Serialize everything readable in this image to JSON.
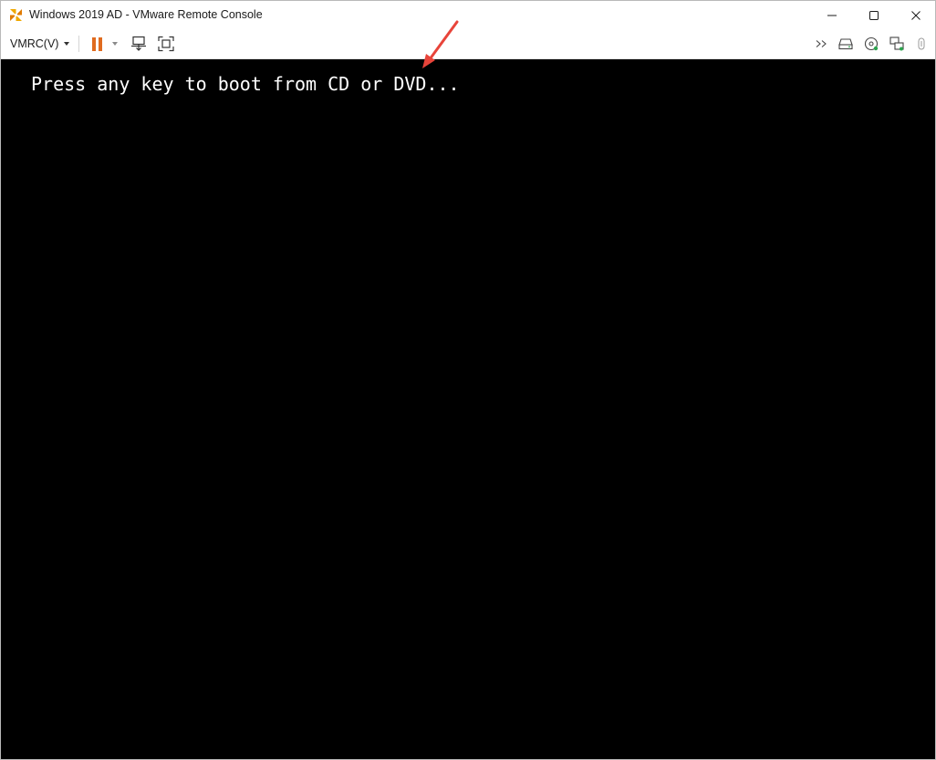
{
  "window": {
    "title": "Windows 2019 AD - VMware Remote Console",
    "app_icon": "vmware-pinwheel-icon",
    "controls": [
      "minimize-icon",
      "maximize-icon",
      "close-icon"
    ]
  },
  "toolbar": {
    "menu_label": "VMRC(V)",
    "left_icons": [
      "pause-icon",
      "dropdown-caret-icon",
      "send-ctrl-alt-del-icon",
      "fullscreen-icon"
    ],
    "right_icons": [
      "chevron-double-right-icon",
      "hard-disk-icon",
      "cd-dvd-icon",
      "network-adapter-icon",
      "usb-icon"
    ],
    "accent_color": "#e06b1f"
  },
  "console": {
    "boot_message": "Press any key to boot from CD or DVD...",
    "background_color": "#000000",
    "text_color": "#ffffff"
  },
  "annotation": {
    "arrow_color": "#e8443a"
  }
}
